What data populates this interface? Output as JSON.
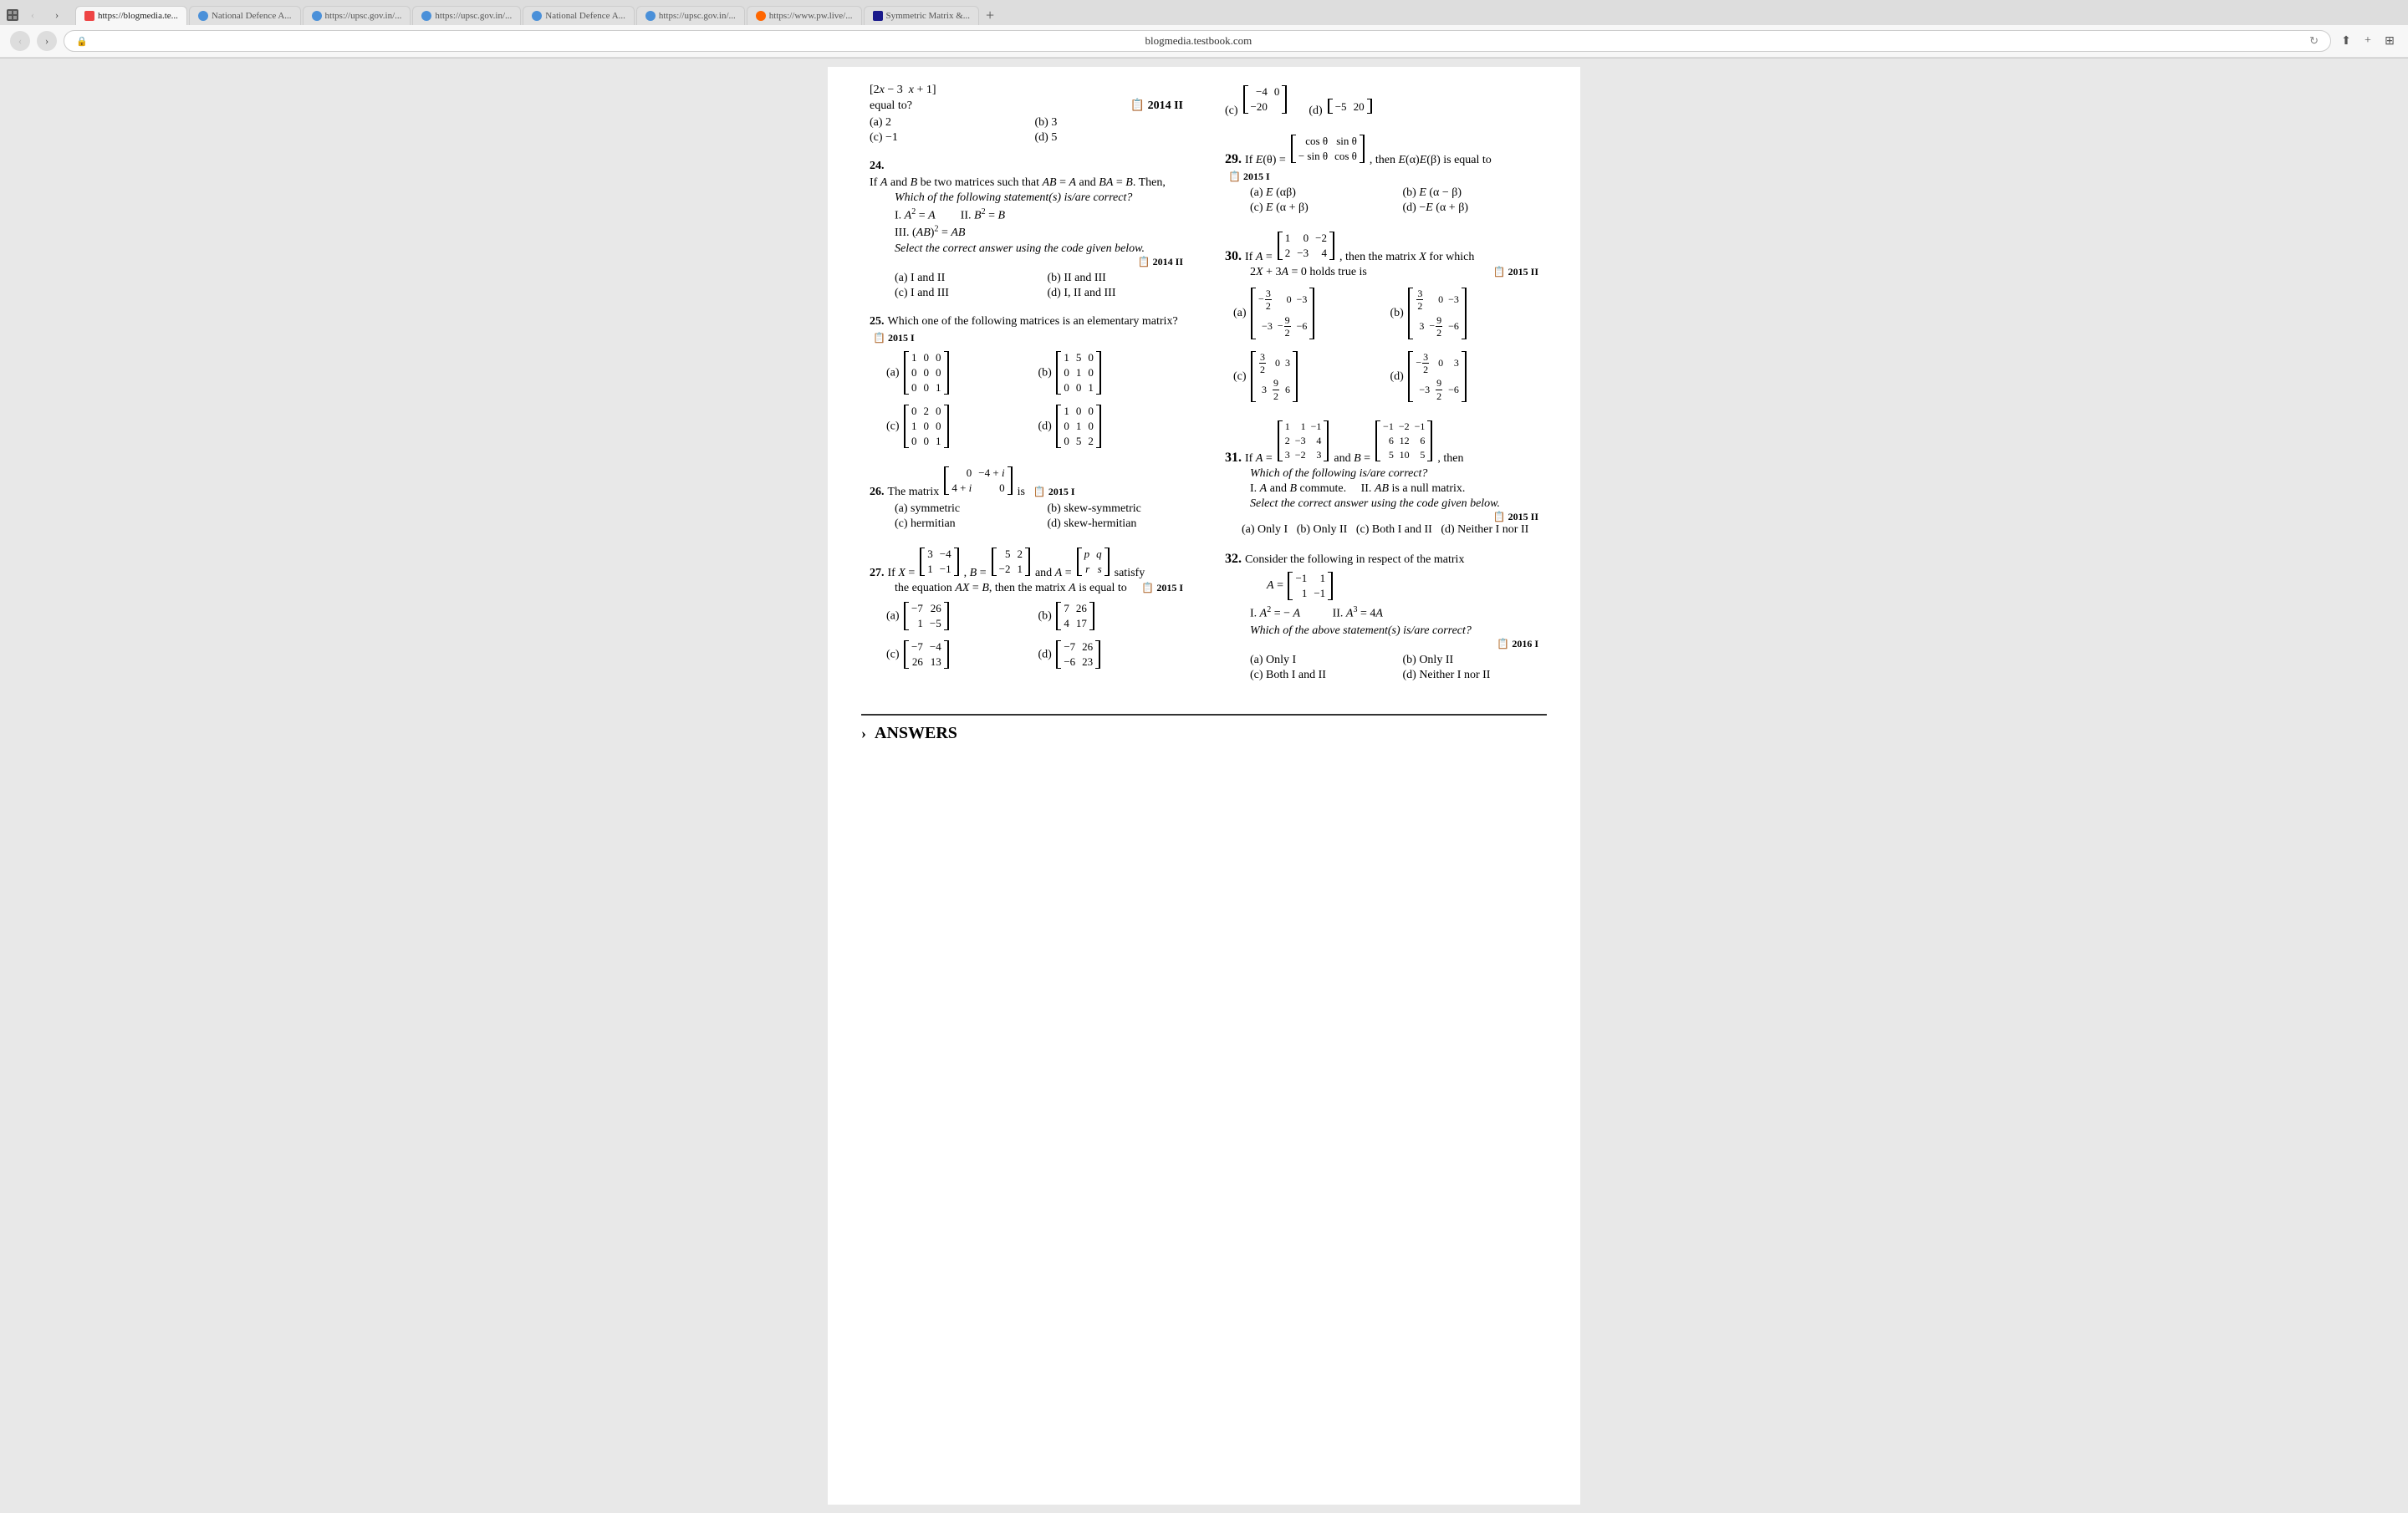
{
  "browser": {
    "url": "blogmedia.testbook.com",
    "tabs": [
      {
        "label": "https://blogmedia.te...",
        "favicon": "blog",
        "active": true
      },
      {
        "label": "National Defence A...",
        "favicon": "u",
        "active": false
      },
      {
        "label": "https://upsc.gov.in/...",
        "favicon": "upsc",
        "active": false
      },
      {
        "label": "https://upsc.gov.in/...",
        "favicon": "upsc",
        "active": false
      },
      {
        "label": "National Defence A...",
        "favicon": "u",
        "active": false
      },
      {
        "label": "https://upsc.gov.in/...",
        "favicon": "upsc",
        "active": false
      },
      {
        "label": "https://www.pw.live/...",
        "favicon": "pw",
        "active": false
      },
      {
        "label": "Symmetric Matrix &...",
        "favicon": "b",
        "active": false
      }
    ]
  },
  "content": {
    "q24": {
      "number": "24.",
      "text": "If A and B be two matrices such that AB = A and BA = B. Then,",
      "subtext": "Which of the following statement(s) is/are correct?",
      "statements": [
        "I. A² = A",
        "II. B² = B",
        "III. (AB)² = AB"
      ],
      "footer": "Select the correct answer using the code given below.",
      "year": "2014 II",
      "options": [
        "(a) I and II",
        "(b) II and III",
        "(c) I and III",
        "(d) I, II and III"
      ]
    },
    "q25": {
      "number": "25.",
      "text": "Which one of the following matrices is an elementary matrix?",
      "year": "2015 I"
    },
    "q26": {
      "number": "26.",
      "text": "The matrix",
      "suffix": "is",
      "year": "2015 I",
      "options": [
        "(a) symmetric",
        "(b) skew-symmetric",
        "(c) hermitian",
        "(d) skew-hermitian"
      ]
    },
    "q27": {
      "number": "27.",
      "year": "2015 I"
    },
    "q29": {
      "number": "29.",
      "year": "2015 I"
    },
    "q30": {
      "number": "30.",
      "year": "2015 II"
    },
    "q31": {
      "number": "31.",
      "year": "2015 II"
    },
    "q32": {
      "number": "32.",
      "year": "2016 I"
    },
    "answers": "ANSWERS"
  }
}
